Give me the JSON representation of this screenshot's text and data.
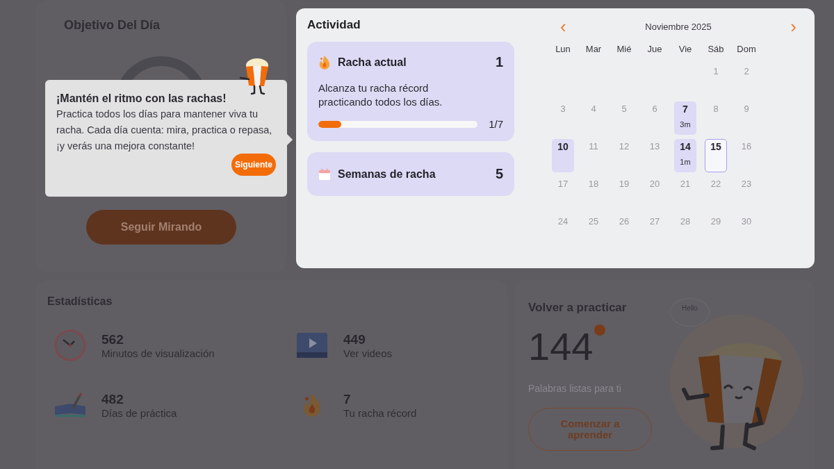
{
  "goal_card": {
    "title": "Objetivo Del Día",
    "button": "Seguir Mirando"
  },
  "tooltip": {
    "title": "¡Mantén el ritmo con las rachas!",
    "text": "Practica todos los días para mantener viva tu racha. Cada día cuenta: mira, practica o repasa, ¡y verás una mejora constante!",
    "button": "Siguiente"
  },
  "activity": {
    "title": "Actividad",
    "current_streak": {
      "label": "Racha actual",
      "value": "1",
      "description": "Alcanza tu racha récord practicando todos los días.",
      "level": 0.143,
      "reading": "1/7"
    },
    "streak_weeks": {
      "label": "Semanas de racha",
      "value": "5"
    }
  },
  "calendar": {
    "prev": "‹",
    "month": "Noviembre 2025",
    "next": "›",
    "weekdays": [
      "Lun",
      "Mar",
      "Mié",
      "Jue",
      "Vie",
      "Sáb",
      "Dom"
    ],
    "weeks": [
      [
        {
          "day": "1",
          "practiced": false,
          "today": false
        },
        {
          "day": "2",
          "practiced": false,
          "today": false
        }
      ],
      [
        {
          "day": "3",
          "practiced": false,
          "today": false
        },
        {
          "day": "4",
          "practiced": false,
          "today": false
        },
        {
          "day": "5",
          "practiced": false,
          "today": false
        },
        {
          "day": "6",
          "practiced": false,
          "today": false
        },
        {
          "day": "7",
          "minutes": "3m",
          "practiced": true,
          "today": false
        },
        {
          "day": "8",
          "practiced": false,
          "today": false
        },
        {
          "day": "9",
          "practiced": false,
          "today": false
        }
      ],
      [
        {
          "day": "10",
          "practiced": true,
          "today": false
        },
        {
          "day": "11",
          "practiced": false,
          "today": false
        },
        {
          "day": "12",
          "practiced": false,
          "today": false
        },
        {
          "day": "13",
          "practiced": false,
          "today": false
        },
        {
          "day": "14",
          "minutes": "1m",
          "practiced": true,
          "today": false
        },
        {
          "day": "15",
          "practiced": false,
          "today": true
        },
        {
          "day": "16",
          "practiced": false,
          "today": false
        }
      ],
      [
        {
          "day": "17",
          "practiced": false,
          "today": false
        },
        {
          "day": "18",
          "practiced": false,
          "today": false
        },
        {
          "day": "19",
          "practiced": false,
          "today": false
        },
        {
          "day": "20",
          "practiced": false,
          "today": false
        },
        {
          "day": "21",
          "practiced": false,
          "today": false
        },
        {
          "day": "22",
          "practiced": false,
          "today": false
        },
        {
          "day": "23",
          "practiced": false,
          "today": false
        }
      ],
      [
        {
          "day": "24",
          "practiced": false,
          "today": false
        },
        {
          "day": "25",
          "practiced": false,
          "today": false
        },
        {
          "day": "26",
          "practiced": false,
          "today": false
        },
        {
          "day": "27",
          "practiced": false,
          "today": false
        },
        {
          "day": "28",
          "practiced": false,
          "today": false
        },
        {
          "day": "29",
          "practiced": false,
          "today": false
        },
        {
          "day": "30",
          "practiced": false,
          "today": false
        }
      ]
    ]
  },
  "statistics": {
    "title": "Estadísticas",
    "items": [
      {
        "kind": "clock",
        "value": "562",
        "label": "Minutos de visualización"
      },
      {
        "kind": "video",
        "value": "449",
        "label": "Ver videos"
      },
      {
        "kind": "book",
        "value": "482",
        "label": "Días de práctica"
      },
      {
        "kind": "flame",
        "value": "7",
        "label": "Tu racha récord"
      }
    ]
  },
  "practice": {
    "title": "Volver a practicar",
    "value": "144",
    "caption": "Palabras listas para ti",
    "button": "Comenzar a aprender",
    "bubble": "Hello"
  }
}
